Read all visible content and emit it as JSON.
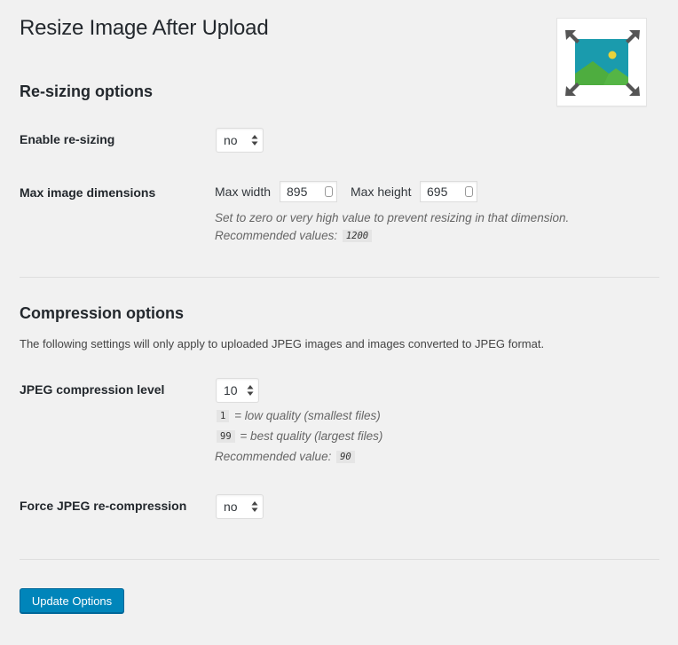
{
  "page": {
    "title": "Resize Image After Upload"
  },
  "resizing": {
    "section_title": "Re-sizing options",
    "enable_label": "Enable re-sizing",
    "enable_value": "no",
    "dimensions_label": "Max image dimensions",
    "width_label": "Max width",
    "width_value": "895",
    "height_label": "Max height",
    "height_value": "695",
    "hint_text": "Set to zero or very high value to prevent resizing in that dimension.",
    "recommended_prefix": "Recommended values:",
    "recommended_value": "1200"
  },
  "compression": {
    "section_title": "Compression options",
    "intro": "The following settings will only apply to uploaded JPEG images and images converted to JPEG format.",
    "level_label": "JPEG compression level",
    "level_value": "10",
    "low_code": "1",
    "low_text": "= low quality (smallest files)",
    "best_code": "99",
    "best_text": "= best quality (largest files)",
    "recommended_prefix": "Recommended value:",
    "recommended_value": "90",
    "force_label": "Force JPEG re-compression",
    "force_value": "no"
  },
  "actions": {
    "update_label": "Update Options"
  },
  "colors": {
    "page_background": "#f1f1f1",
    "primary_button": "#0085ba",
    "logo_teal": "#1a9bad",
    "logo_green": "#55b545",
    "logo_sun": "#e9d23a",
    "logo_arrows": "#555555"
  },
  "icons": {
    "plugin_logo": "resize-image-logo-icon",
    "select_arrows": "chevron-updown-icon",
    "spinner": "number-spinner-icon"
  }
}
